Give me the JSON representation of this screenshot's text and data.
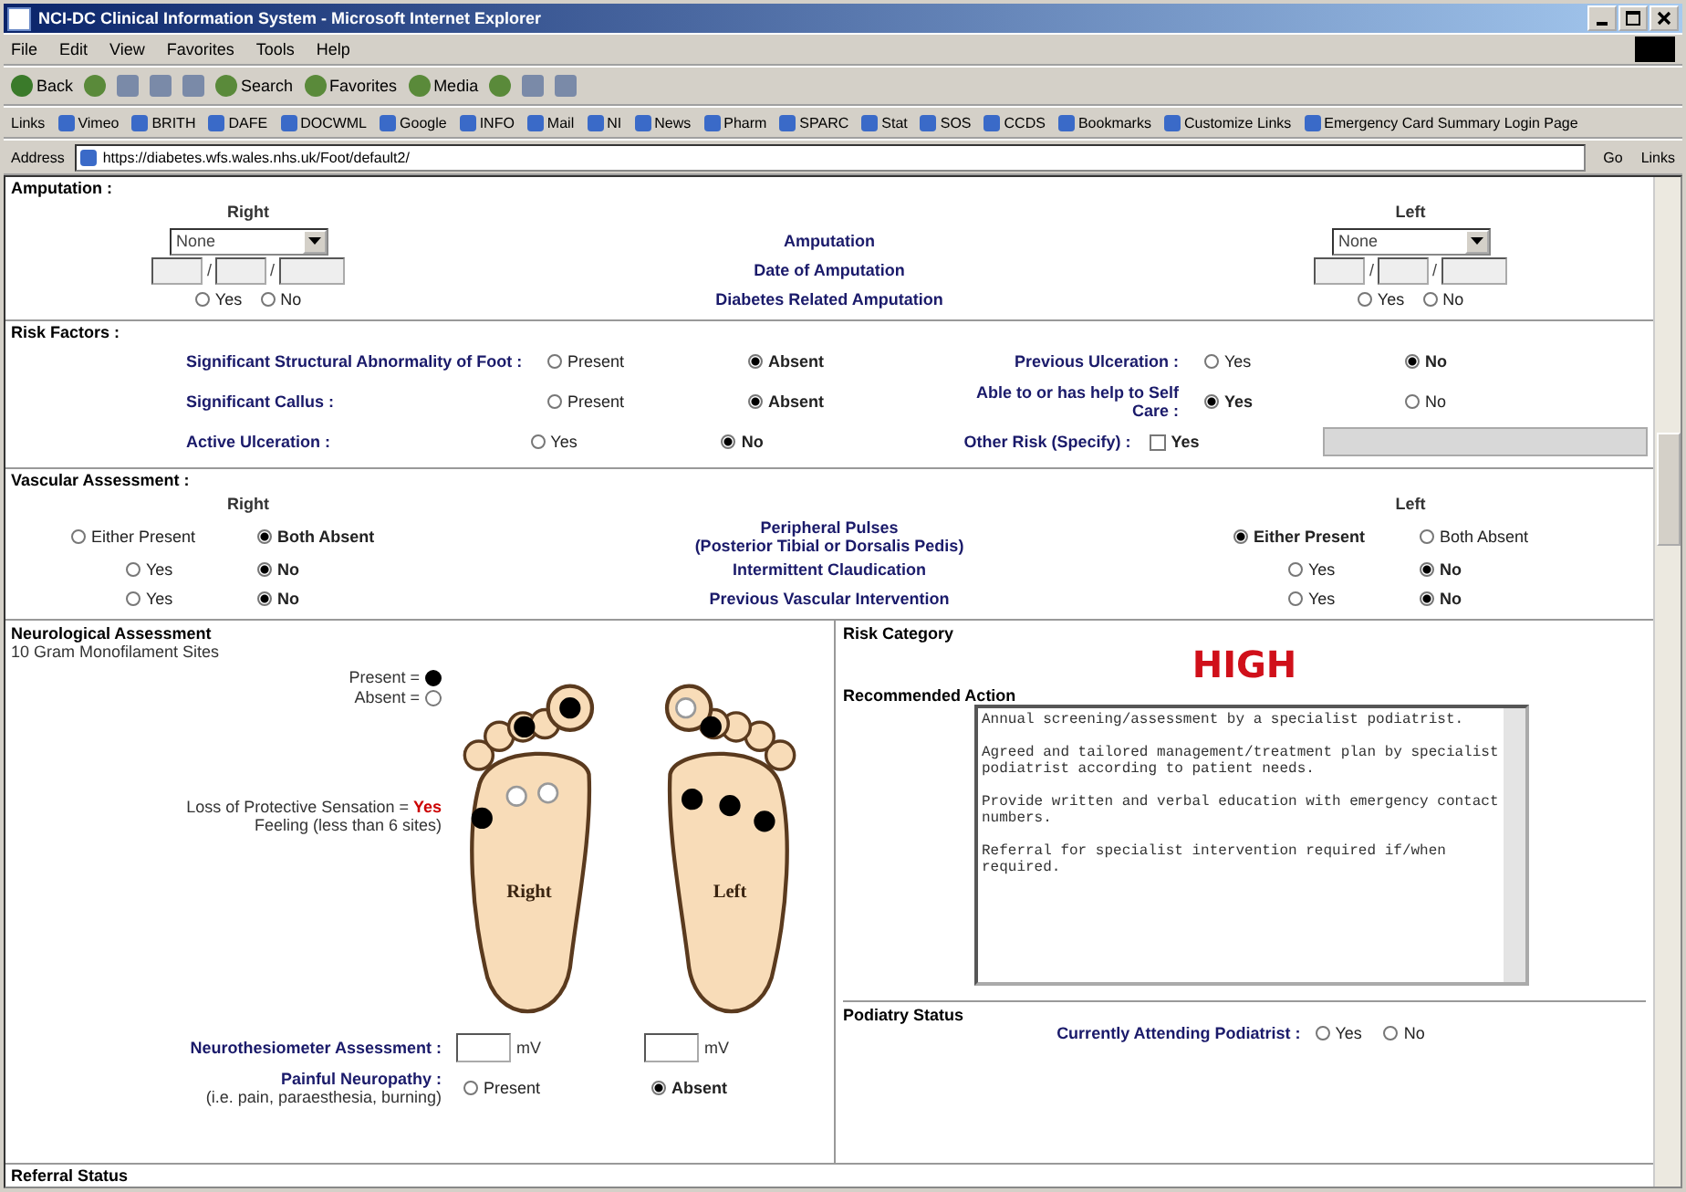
{
  "window": {
    "title": "NCI-DC Clinical Information System - Microsoft Internet Explorer"
  },
  "menu": [
    "File",
    "Edit",
    "View",
    "Favorites",
    "Tools",
    "Help"
  ],
  "toolbar": [
    "Back",
    "Search",
    "Favorites",
    "Media"
  ],
  "links_bar": {
    "label": "Links",
    "items": [
      "Vimeo",
      "BRITH",
      "DAFE",
      "DOCWML",
      "Google",
      "INFO",
      "Mail",
      "NI",
      "News",
      "Pharm",
      "SPARC",
      "Stat",
      "SOS",
      "CCDS",
      "Bookmarks",
      "Customize Links",
      "Emergency Card Summary Login Page"
    ]
  },
  "address_bar": {
    "label": "Address",
    "value": "https://diabetes.wfs.wales.nhs.uk/Foot/default2/",
    "go": "Go",
    "links": "Links"
  },
  "amputation": {
    "title": "Amputation :",
    "right_label": "Right",
    "left_label": "Left",
    "rows": [
      {
        "kind": "select",
        "label": "Amputation",
        "right": "None",
        "left": "None"
      },
      {
        "kind": "date",
        "label": "Date of Amputation",
        "separator": "/"
      },
      {
        "kind": "radio",
        "label": "Diabetes Related Amputation",
        "right": [
          {
            "label": "Yes",
            "selected": false
          },
          {
            "label": "No",
            "selected": false
          }
        ],
        "left": [
          {
            "label": "Yes",
            "selected": false
          },
          {
            "label": "No",
            "selected": false
          }
        ]
      }
    ]
  },
  "risk_factors": {
    "title": "Risk Factors :",
    "rows": [
      {
        "label": "Significant Structural Abnormality of Foot :",
        "options": [
          {
            "label": "Present",
            "selected": false
          },
          {
            "label": "Absent",
            "selected": true
          }
        ],
        "label_2": "Previous Ulceration :",
        "kind": "radio",
        "options_2": [
          {
            "label": "Yes",
            "selected": false
          },
          {
            "label": "No",
            "selected": true
          }
        ]
      },
      {
        "label": "Significant Callus :",
        "options": [
          {
            "label": "Present",
            "selected": false
          },
          {
            "label": "Absent",
            "selected": true
          }
        ],
        "label_2": "Able to or has help to Self Care :",
        "kind": "radio",
        "options_2": [
          {
            "label": "Yes",
            "selected": true
          },
          {
            "label": "No",
            "selected": false
          }
        ]
      },
      {
        "label": "Active Ulceration :",
        "options": [
          {
            "label": "Yes",
            "selected": false
          },
          {
            "label": "No",
            "selected": true
          }
        ],
        "label_2": "Other Risk (Specify) :",
        "kind": "checkbox",
        "options_2": [
          {
            "label": "Yes",
            "checked": false
          }
        ]
      }
    ]
  },
  "vascular": {
    "title": "Vascular Assessment :",
    "right_label": "Right",
    "left_label": "Left",
    "rows": [
      {
        "label": "Peripheral Pulses",
        "sublabel": "(Posterior Tibial or Dorsalis Pedis)",
        "right": [
          {
            "label": "Either Present",
            "selected": false
          },
          {
            "label": "Both Absent",
            "selected": true
          }
        ],
        "left": [
          {
            "label": "Either Present",
            "selected": true
          },
          {
            "label": "Both Absent",
            "selected": false
          }
        ]
      },
      {
        "label": "Intermittent Claudication",
        "right": [
          {
            "label": "Yes",
            "selected": false
          },
          {
            "label": "No",
            "selected": true
          }
        ],
        "left": [
          {
            "label": "Yes",
            "selected": false
          },
          {
            "label": "No",
            "selected": true
          }
        ]
      },
      {
        "label": "Previous Vascular Intervention",
        "right": [
          {
            "label": "Yes",
            "selected": false
          },
          {
            "label": "No",
            "selected": true
          }
        ],
        "left": [
          {
            "label": "Yes",
            "selected": false
          },
          {
            "label": "No",
            "selected": true
          }
        ]
      }
    ]
  },
  "neuro": {
    "title": "Neurological Assessment",
    "subtitle": "10 Gram Monofilament Sites",
    "legend_present": "Present =",
    "legend_absent": "Absent =",
    "loss_text": "Loss of Protective Sensation = **Yes**",
    "loss_note": "Feeling (less than 6 sites)",
    "right_foot": {
      "label": "Right",
      "sites": [
        {
          "present": true
        },
        {
          "present": true
        },
        {
          "present": false
        },
        {
          "present": false
        },
        {
          "present": true
        }
      ]
    },
    "left_foot": {
      "label": "Left",
      "sites": [
        {
          "present": false
        },
        {
          "present": true
        },
        {
          "present": true
        },
        {
          "present": true
        },
        {
          "present": true
        }
      ]
    },
    "neurothesiometer": {
      "label": "Neurothesiometer Assessment :",
      "unit_right": "mV",
      "unit_left": "mV"
    },
    "painful": {
      "label": "Painful Neuropathy :",
      "note": "(i.e. pain, paraesthesia, burning)",
      "options": [
        {
          "label": "Present",
          "selected": false
        },
        {
          "label": "Absent",
          "selected": true
        }
      ]
    }
  },
  "risk_category": {
    "title": "Risk Category",
    "value": "HIGH",
    "action_label": "Recommended Action",
    "action_text": "Annual screening/assessment by a specialist podiatrist.\n\nAgreed and tailored management/treatment plan by specialist podiatrist according to patient needs.\n\nProvide written and verbal education with emergency contact numbers.\n\nReferral for specialist intervention required if/when required."
  },
  "podiatry": {
    "title": "Podiatry Status",
    "label": "Currently Attending Podiatrist :",
    "options": [
      {
        "label": "Yes",
        "selected": false
      },
      {
        "label": "No",
        "selected": false
      }
    ]
  },
  "referral": {
    "title": "Referral Status"
  }
}
